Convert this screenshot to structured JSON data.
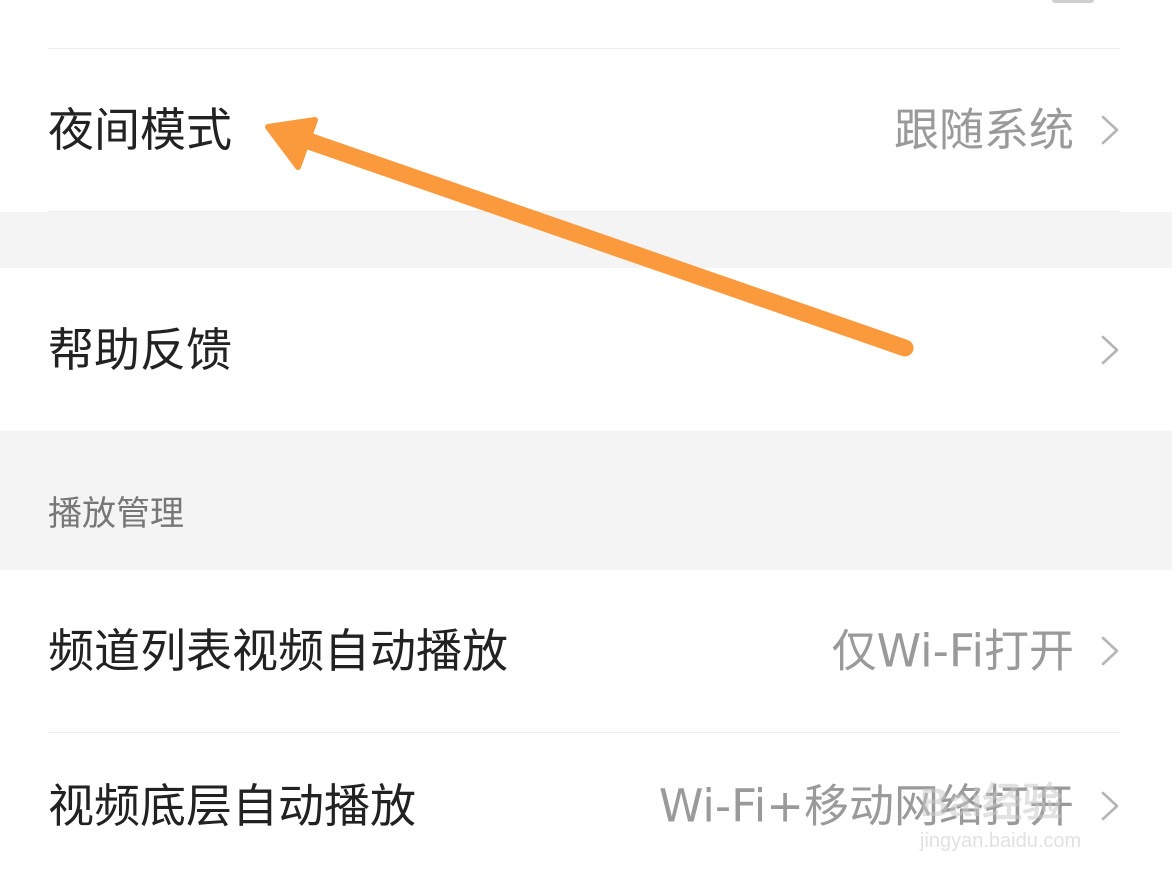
{
  "settings": {
    "night_mode": {
      "label": "夜间模式",
      "value": "跟随系统"
    },
    "help_feedback": {
      "label": "帮助反馈"
    },
    "playback_section": {
      "title": "播放管理"
    },
    "channel_autoplay": {
      "label": "频道列表视频自动播放",
      "value": "仅Wi-Fi打开"
    },
    "bottom_autoplay": {
      "label": "视频底层自动播放",
      "value": "Wi-Fi+移动网络打开"
    }
  },
  "annotation": {
    "arrow_color": "#FA9A3C"
  },
  "watermark": {
    "brand": "Bai经验",
    "url": "jingyan.baidu.com"
  },
  "icons": {
    "chevron": "chevron-right-icon"
  }
}
